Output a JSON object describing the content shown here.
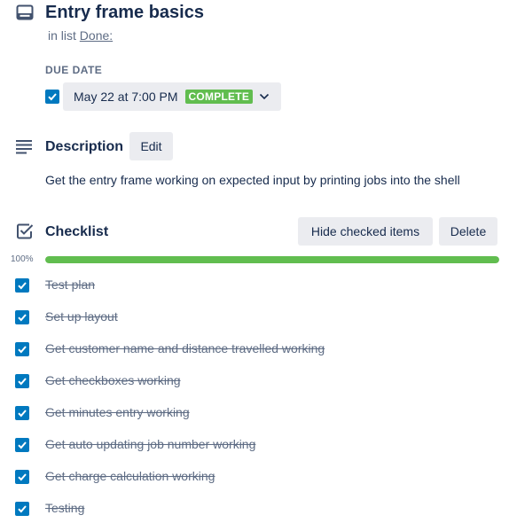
{
  "card": {
    "title": "Entry frame basics",
    "in_list_prefix": "in list ",
    "list_name": "Done:",
    "icon": "card-icon"
  },
  "due_date": {
    "label": "DUE DATE",
    "value": "May 22 at 7:00 PM",
    "status": "COMPLETE",
    "checked": true
  },
  "description": {
    "title": "Description",
    "edit_label": "Edit",
    "text": "Get the entry frame working on expected input by printing jobs into the shell",
    "icon": "description-lines-icon"
  },
  "checklist": {
    "title": "Checklist",
    "hide_label": "Hide checked items",
    "delete_label": "Delete",
    "progress_label": "100%",
    "progress": 1.0,
    "icon": "checklist-icon",
    "items": [
      {
        "label": "Test plan",
        "checked": true
      },
      {
        "label": "Set up layout",
        "checked": true
      },
      {
        "label": "Get customer name and distance travelled working",
        "checked": true
      },
      {
        "label": "Get checkboxes working",
        "checked": true
      },
      {
        "label": "Get minutes entry working",
        "checked": true
      },
      {
        "label": "Get auto updating job number working",
        "checked": true
      },
      {
        "label": "Get charge calculation working",
        "checked": true
      },
      {
        "label": "Testing",
        "checked": true
      }
    ]
  },
  "colors": {
    "primary_text": "#172b4d",
    "secondary_text": "#5e6c84",
    "button_bg": "#ebecf0",
    "checkbox": "#0079bf",
    "success": "#61bd4f"
  }
}
